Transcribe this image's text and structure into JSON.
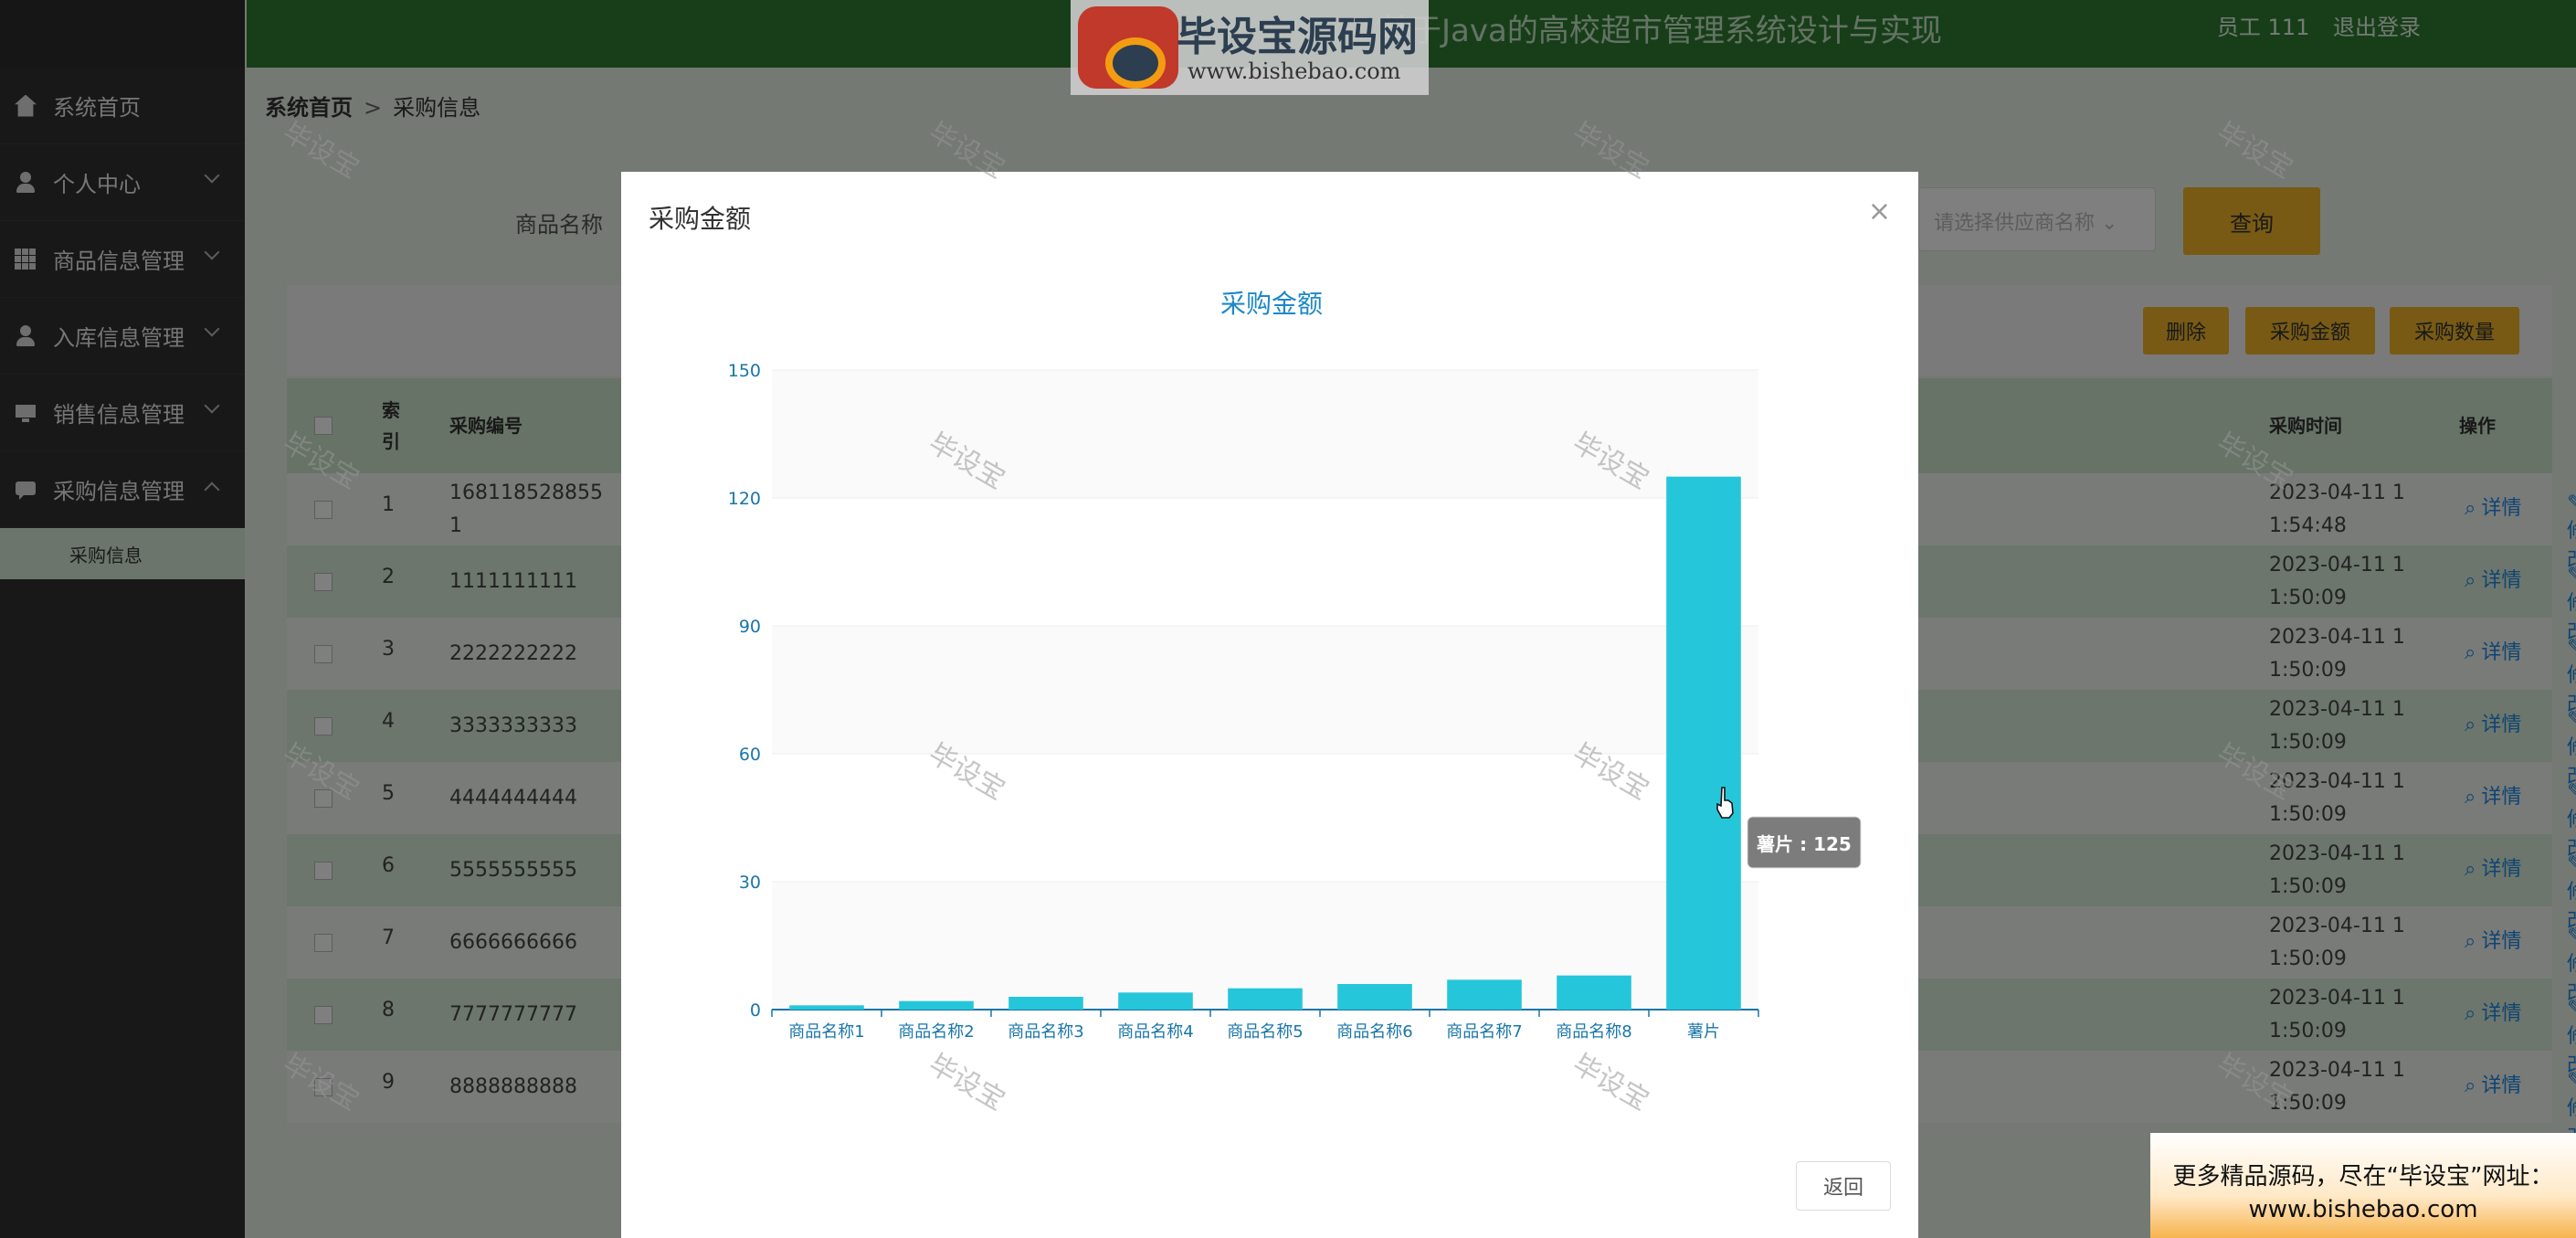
{
  "header": {
    "title": "基于Java的高校超市管理系统设计与实现",
    "user": "员工 111",
    "logout": "退出登录"
  },
  "sidebar": {
    "items": [
      {
        "label": "系统首页",
        "icon": "home-icon",
        "expandable": false
      },
      {
        "label": "个人中心",
        "icon": "user-icon",
        "expandable": true
      },
      {
        "label": "商品信息管理",
        "icon": "grid-icon",
        "expandable": true
      },
      {
        "label": "入库信息管理",
        "icon": "user-icon",
        "expandable": true
      },
      {
        "label": "销售信息管理",
        "icon": "monitor-icon",
        "expandable": true
      },
      {
        "label": "采购信息管理",
        "icon": "chat-icon",
        "expandable": true,
        "expanded": true
      }
    ],
    "sub_item": "采购信息"
  },
  "breadcrumb": {
    "home": "系统首页",
    "separator": ">",
    "current": "采购信息"
  },
  "search": {
    "label": "商品名称",
    "supplier_placeholder": "请选择供应商名称",
    "query": "查询"
  },
  "toolbar": {
    "delete": "删除",
    "amount": "采购金额",
    "quantity": "采购数量"
  },
  "table": {
    "headers": {
      "index": "索引",
      "number": "采购编号",
      "time": "采购时间",
      "actions": "操作"
    },
    "actions": {
      "detail": "详情",
      "edit": "修改",
      "delete": "删除"
    },
    "rows": [
      {
        "index": "1",
        "number": "168118528855\n1",
        "time": "2023-04-11 1\n1:54:48"
      },
      {
        "index": "2",
        "number": "1111111111",
        "time": "2023-04-11 1\n1:50:09"
      },
      {
        "index": "3",
        "number": "2222222222",
        "time": "2023-04-11 1\n1:50:09"
      },
      {
        "index": "4",
        "number": "3333333333",
        "time": "2023-04-11 1\n1:50:09"
      },
      {
        "index": "5",
        "number": "4444444444",
        "time": "2023-04-11 1\n1:50:09"
      },
      {
        "index": "6",
        "number": "5555555555",
        "time": "2023-04-11 1\n1:50:09"
      },
      {
        "index": "7",
        "number": "6666666666",
        "time": "2023-04-11 1\n1:50:09"
      },
      {
        "index": "8",
        "number": "7777777777",
        "time": "2023-04-11 1\n1:50:09"
      },
      {
        "index": "9",
        "number": "8888888888",
        "time": "2023-04-11 1\n1:50:09"
      }
    ]
  },
  "modal": {
    "title": "采购金额",
    "close": "×",
    "return": "返回"
  },
  "chart_data": {
    "type": "bar",
    "title": "采购金额",
    "categories": [
      "商品名称1",
      "商品名称2",
      "商品名称3",
      "商品名称4",
      "商品名称5",
      "商品名称6",
      "商品名称7",
      "商品名称8",
      "薯片"
    ],
    "values": [
      1,
      2,
      3,
      4,
      5,
      6,
      7,
      8,
      125
    ],
    "ylim": [
      0,
      150
    ],
    "yticks": [
      0,
      30,
      60,
      90,
      120,
      150
    ],
    "bar_color": "#26c6da",
    "axis_color": "#1976a8",
    "tooltip": {
      "category": "薯片",
      "value": 125,
      "text": "薯片 : 125"
    }
  },
  "watermark": {
    "logo_text": "毕设宝源码网",
    "logo_url": "www.bishebao.com",
    "stamp": "毕设宝",
    "banner_line1": "更多精品源码，尽在“毕设宝”网址：",
    "banner_line2": "www.bishebao.com"
  },
  "colors": {
    "header": "#2e7d32",
    "sidebar": "#303030",
    "accent": "#f0b429",
    "link": "#1e88e5",
    "danger": "#e53935"
  }
}
